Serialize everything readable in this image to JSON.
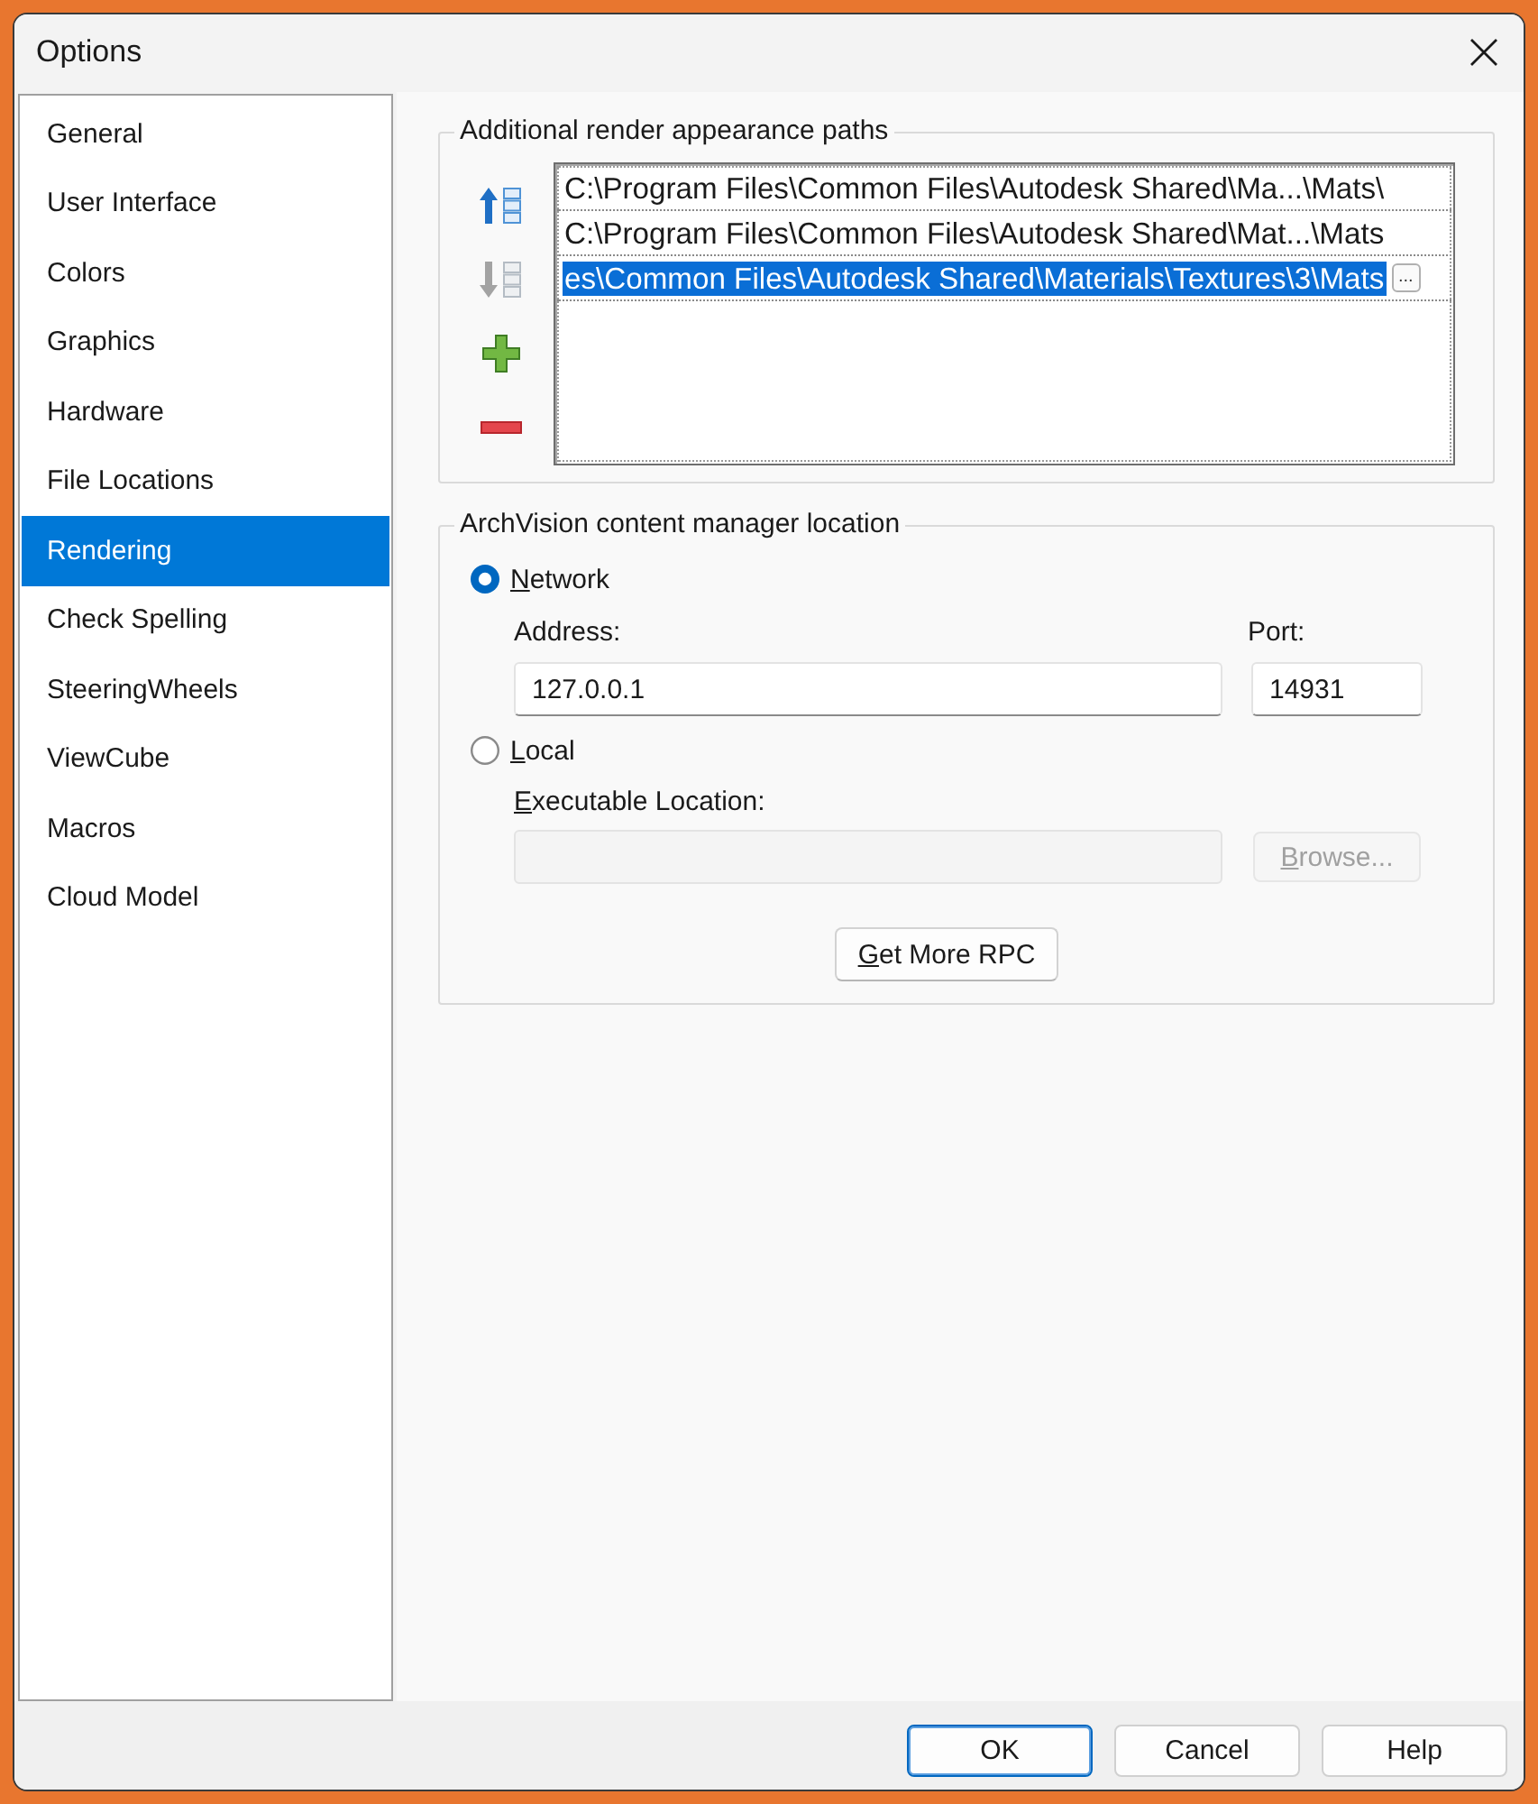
{
  "window": {
    "title": "Options"
  },
  "sidebar": {
    "items": [
      {
        "label": "General",
        "selected": false
      },
      {
        "label": "User Interface",
        "selected": false
      },
      {
        "label": "Colors",
        "selected": false
      },
      {
        "label": "Graphics",
        "selected": false
      },
      {
        "label": "Hardware",
        "selected": false
      },
      {
        "label": "File Locations",
        "selected": false
      },
      {
        "label": "Rendering",
        "selected": true
      },
      {
        "label": "Check Spelling",
        "selected": false
      },
      {
        "label": "SteeringWheels",
        "selected": false
      },
      {
        "label": "ViewCube",
        "selected": false
      },
      {
        "label": "Macros",
        "selected": false
      },
      {
        "label": "Cloud Model",
        "selected": false
      }
    ]
  },
  "render_paths": {
    "title": "Additional render appearance paths",
    "toolbar": [
      {
        "kind": "move_up",
        "disabled": false
      },
      {
        "kind": "move_down",
        "disabled": true
      },
      {
        "kind": "add",
        "disabled": false
      },
      {
        "kind": "remove",
        "disabled": false
      }
    ],
    "paths": [
      {
        "text": "C:\\Program Files\\Common Files\\Autodesk Shared\\Ma...\\Mats\\",
        "selected": false
      },
      {
        "text": "C:\\Program Files\\Common Files\\Autodesk Shared\\Mat...\\Mats",
        "selected": false
      },
      {
        "text": "es\\Common Files\\Autodesk Shared\\Materials\\Textures\\3\\Mats",
        "selected": true,
        "button_label": "..."
      }
    ]
  },
  "archvision": {
    "title": "ArchVision content manager location",
    "network": {
      "label": "Network",
      "selected": true,
      "mnemonic": true
    },
    "address": {
      "label": "Address:",
      "value": "127.0.0.1"
    },
    "port": {
      "label": "Port:",
      "value": "14931"
    },
    "local": {
      "label": "Local",
      "selected": false,
      "mnemonic": true
    },
    "executable": {
      "label": "Executable Location:",
      "mnemonic": true,
      "disabled": true
    },
    "browse": {
      "label": "Browse...",
      "mnemonic": true,
      "disabled": true
    },
    "get_more": {
      "label": "Get More RPC",
      "mnemonic": true
    }
  },
  "buttons": [
    {
      "label": "OK",
      "default": true
    },
    {
      "label": "Cancel",
      "default": false
    },
    {
      "label": "Help",
      "default": false
    }
  ]
}
